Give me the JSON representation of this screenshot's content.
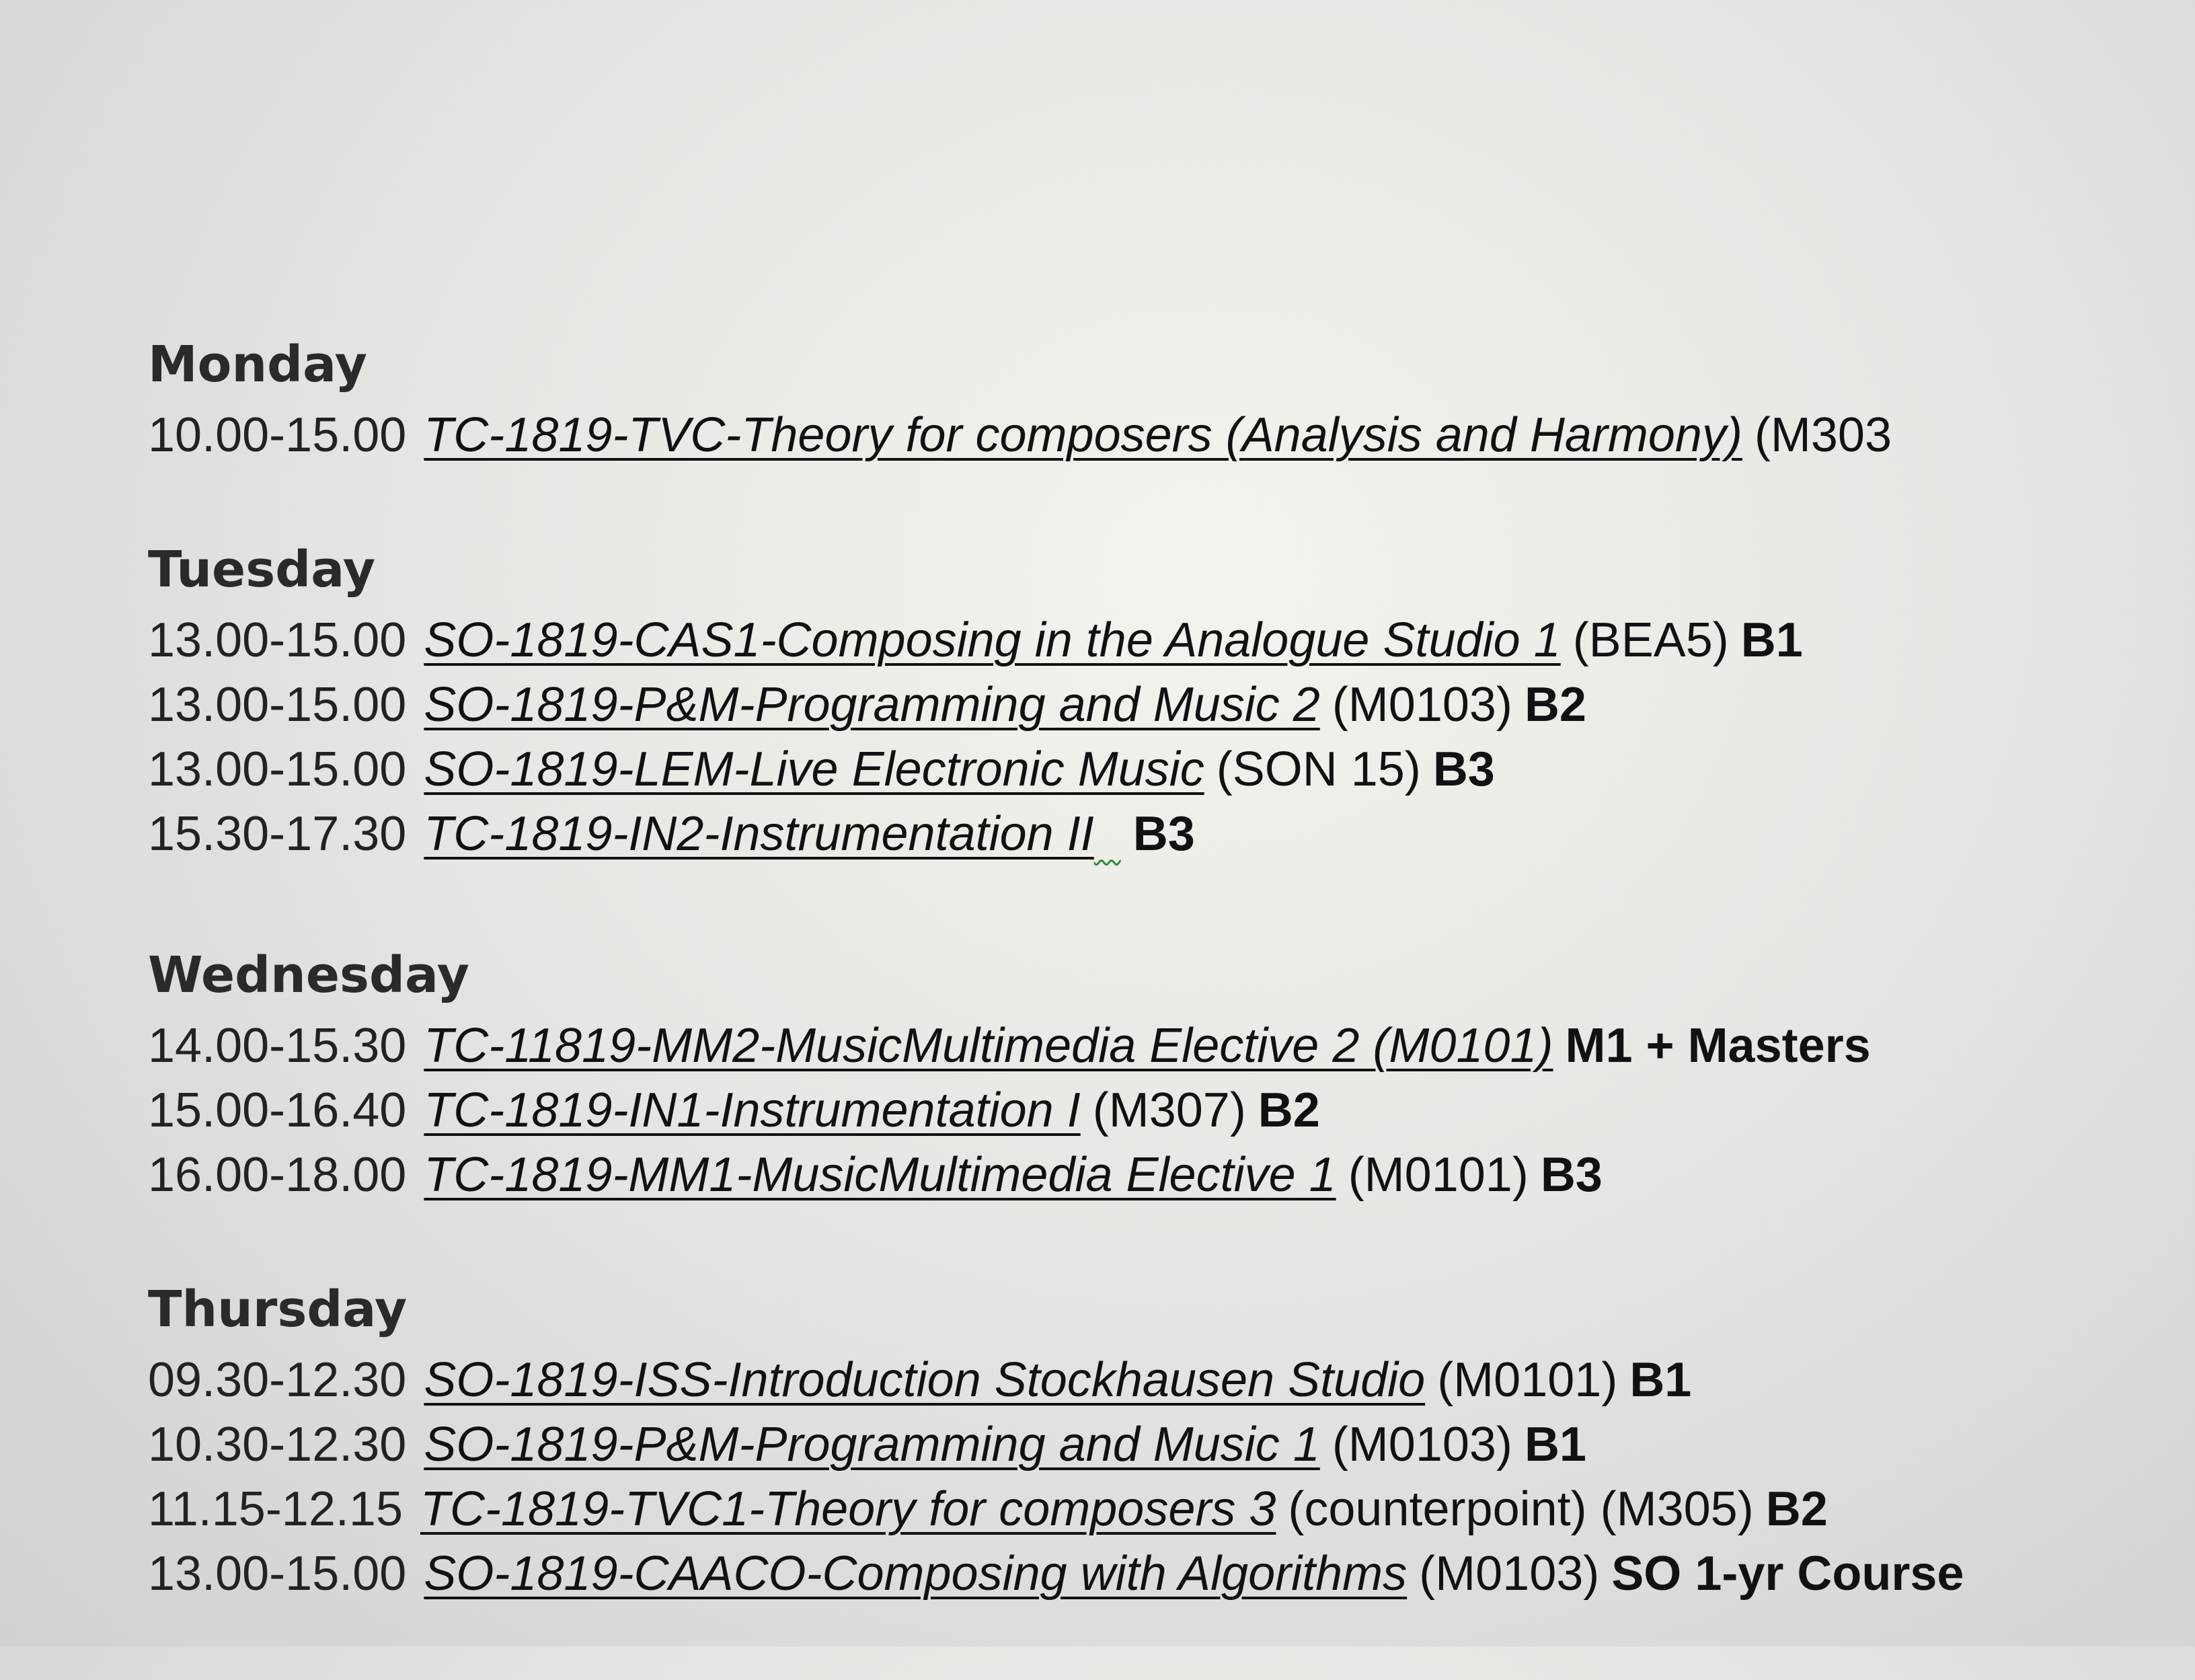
{
  "schedule": {
    "monday": {
      "day": "Monday",
      "rows": [
        {
          "time": "10.00-15.00",
          "course": "TC-1819-TVC-Theory for composers (Analysis and Harmony)",
          "room": "(M303",
          "group": ""
        }
      ]
    },
    "tuesday": {
      "day": "Tuesday",
      "rows": [
        {
          "time": "13.00-15.00",
          "course": "SO-1819-CAS1-Composing in the Analogue Studio 1",
          "room": "(BEA5)",
          "group": "B1"
        },
        {
          "time": "13.00-15.00",
          "course": "SO-1819-P&M-Programming and Music 2",
          "room": "(M0103)",
          "group": "B2"
        },
        {
          "time": "13.00-15.00",
          "course": "SO-1819-LEM-Live Electronic Music",
          "room": "(SON 15)",
          "group": "B3"
        },
        {
          "time": "15.30-17.30",
          "course": "TC-1819-IN2-Instrumentation II",
          "room": "",
          "group": "B3"
        }
      ]
    },
    "wednesday": {
      "day": "Wednesday",
      "rows": [
        {
          "time": "14.00-15.30",
          "course": "TC-11819-MM2-MusicMultimedia Elective 2 (M0101)",
          "room": "",
          "group": "M1 + Masters"
        },
        {
          "time": "15.00-16.40",
          "course": "TC-1819-IN1-Instrumentation I",
          "room": "(M307)",
          "group": "B2"
        },
        {
          "time": "16.00-18.00",
          "course": "TC-1819-MM1-MusicMultimedia Elective 1",
          "room": "(M0101)",
          "group": "B3"
        }
      ]
    },
    "thursday": {
      "day": "Thursday",
      "rows": [
        {
          "time": "09.30-12.30",
          "course": "SO-1819-ISS-Introduction Stockhausen Studio",
          "room": "(M0101)",
          "group": "B1"
        },
        {
          "time": "10.30-12.30",
          "course": "SO-1819-P&M-Programming and Music 1",
          "room": "(M0103)",
          "group": "B1"
        },
        {
          "time": "11.15-12.15",
          "course": "TC-1819-TVC1-Theory for composers 3",
          "room": "(counterpoint) (M305)",
          "group": "B2"
        },
        {
          "time": "13.00-15.00",
          "course": "SO-1819-CAACO-Composing with Algorithms",
          "room": "(M0103)",
          "group": "SO 1-yr Course"
        }
      ]
    }
  }
}
